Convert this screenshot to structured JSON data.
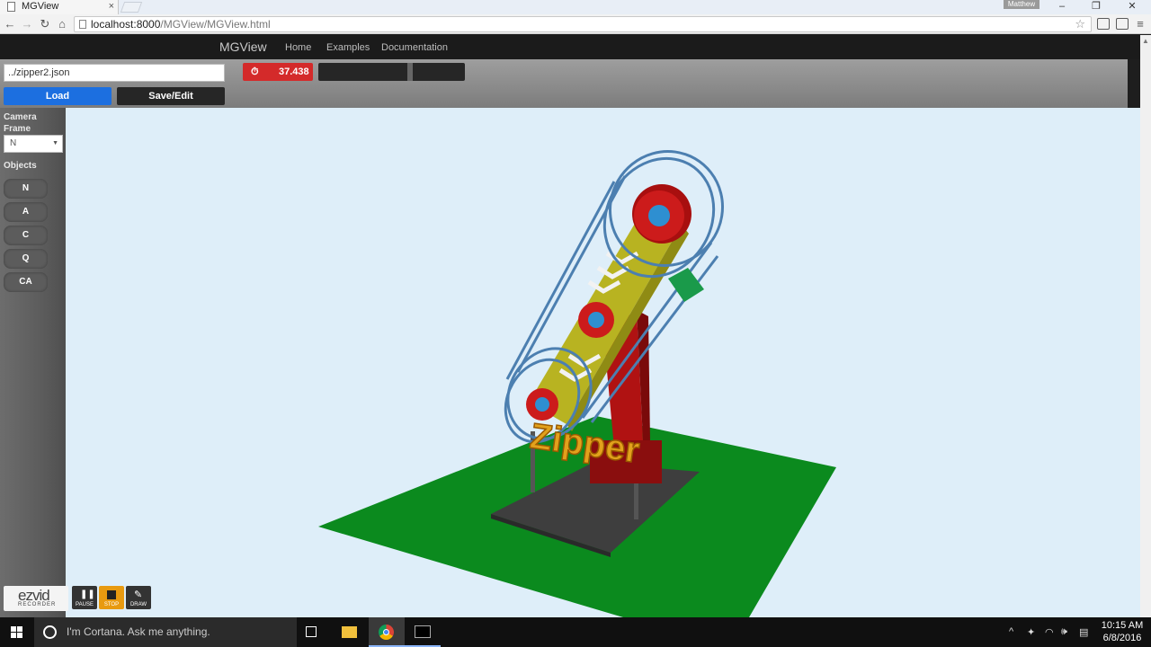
{
  "browser": {
    "tab_title": "MGView",
    "tab_close": "×",
    "profile_name": "Matthew",
    "url_host": "localhost:8000",
    "url_path": "/MGView/MGView.html",
    "window_controls": [
      "–",
      "❐",
      "✕"
    ]
  },
  "app": {
    "brand": "MGView",
    "nav": [
      "Home",
      "Examples",
      "Documentation"
    ],
    "file_path": "../zipper2.json",
    "load_label": "Load",
    "save_label": "Save/Edit",
    "time_value": "37.438"
  },
  "side": {
    "camera_label_1": "Camera",
    "camera_label_2": "Frame",
    "frame_value": "N",
    "objects_label": "Objects",
    "objects": [
      "N",
      "A",
      "C",
      "Q",
      "CA"
    ]
  },
  "scene": {
    "title_text": "Zipper",
    "ground_color": "#0b8a1e",
    "base_color": "#3e3e3e",
    "arm_color": "#b8b321",
    "pillar_color": "#b01212"
  },
  "recorder": {
    "brand_1": "ezvid",
    "brand_2": "RECORDER",
    "buttons": [
      "PAUSE",
      "STOP",
      "DRAW"
    ]
  },
  "taskbar": {
    "search_placeholder": "I'm Cortana. Ask me anything.",
    "time": "10:15 AM",
    "date": "6/8/2016"
  }
}
